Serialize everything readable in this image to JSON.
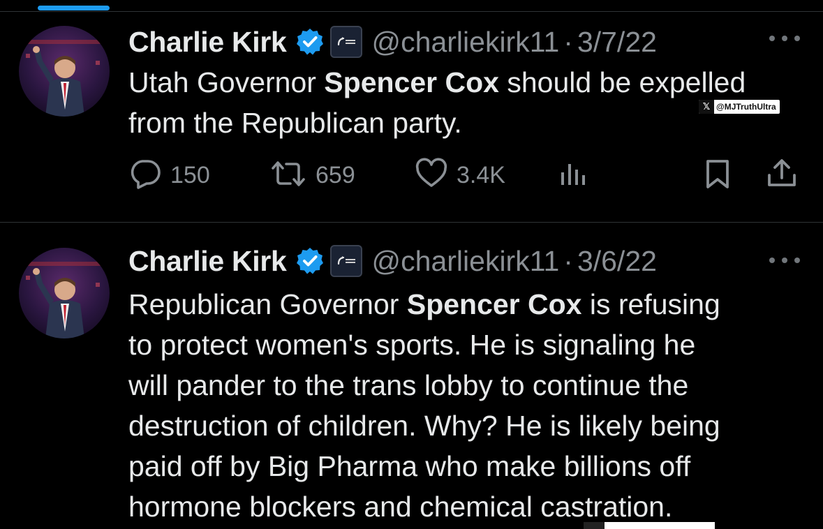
{
  "colors": {
    "background": "#000000",
    "text": "#e7e9ea",
    "muted": "#8b9095",
    "verified": "#1d9bf0",
    "tab_indicator": "#1d9bf0"
  },
  "tweets": [
    {
      "name": "Charlie Kirk",
      "handle": "@charliekirk11",
      "separator": "·",
      "date": "3/7/22",
      "badge_icon": "verified-badge-icon",
      "org_icon": "turning-point-usa-logo",
      "lines": [
        [
          {
            "text": "Utah Governor ",
            "bold": false
          },
          {
            "text": "Spencer Cox",
            "bold": true
          },
          {
            "text": " should be expelled",
            "bold": false
          }
        ],
        [
          {
            "text": "from the Republican party.",
            "bold": false
          }
        ]
      ],
      "stats": {
        "replies": "150",
        "retweets": "659",
        "likes": "3.4K"
      },
      "watermark": "@MJTruthUltra"
    },
    {
      "name": "Charlie Kirk",
      "handle": "@charliekirk11",
      "separator": "·",
      "date": "3/6/22",
      "badge_icon": "verified-badge-icon",
      "org_icon": "turning-point-usa-logo",
      "lines": [
        [
          {
            "text": "Republican Governor ",
            "bold": false
          },
          {
            "text": "Spencer Cox",
            "bold": true
          },
          {
            "text": " is refusing",
            "bold": false
          }
        ],
        [
          {
            "text": "to protect women's sports. He is signaling he",
            "bold": false
          }
        ],
        [
          {
            "text": "will pander to the trans lobby to continue the",
            "bold": false
          }
        ],
        [
          {
            "text": "destruction of children. Why? He is likely being",
            "bold": false
          }
        ],
        [
          {
            "text": "paid off by Big Pharma who make billions off",
            "bold": false
          }
        ],
        [
          {
            "text": "hormone blockers and chemical castration.",
            "bold": false
          }
        ]
      ]
    }
  ]
}
